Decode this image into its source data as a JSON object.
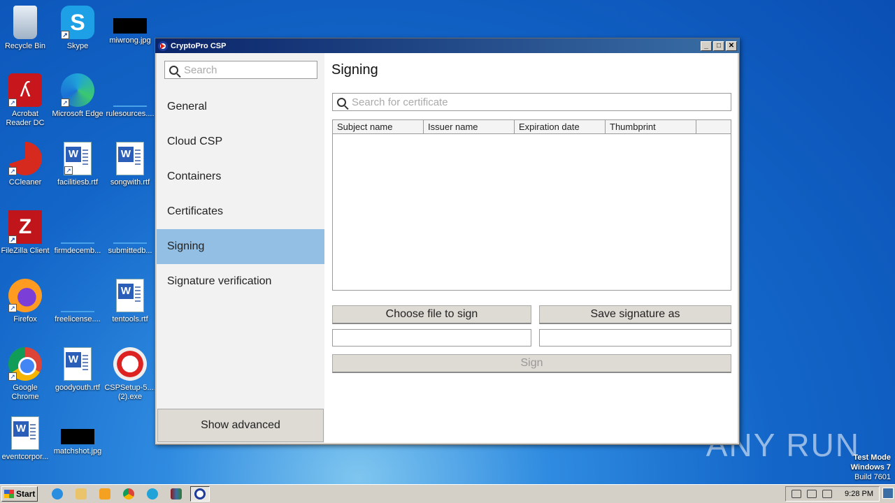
{
  "desktop": {
    "icons": [
      {
        "label": "Recycle Bin"
      },
      {
        "label": "Skype"
      },
      {
        "label": "miwrong.jpg"
      },
      {
        "label": "Acrobat Reader DC"
      },
      {
        "label": "Microsoft Edge"
      },
      {
        "label": "rulesources...."
      },
      {
        "label": "CCleaner"
      },
      {
        "label": "facilitiesb.rtf"
      },
      {
        "label": "songwith.rtf"
      },
      {
        "label": "FileZilla Client"
      },
      {
        "label": "firmdecemb..."
      },
      {
        "label": "submittedb..."
      },
      {
        "label": "Firefox"
      },
      {
        "label": "freelicense...."
      },
      {
        "label": "tentools.rtf"
      },
      {
        "label": "Google Chrome"
      },
      {
        "label": "goodyouth.rtf"
      },
      {
        "label": "CSPSetup-5.... (2).exe"
      },
      {
        "label": "eventcorpor..."
      },
      {
        "label": "matchshot.jpg"
      }
    ],
    "watermark": "ANY RUN",
    "test_mode": {
      "line1": "Test Mode",
      "line2": "Windows 7",
      "line3": "Build 7601"
    }
  },
  "window": {
    "title": "CryptoPro CSP",
    "sidebar": {
      "search_placeholder": "Search",
      "items": [
        {
          "label": "General"
        },
        {
          "label": "Cloud CSP"
        },
        {
          "label": "Containers"
        },
        {
          "label": "Certificates"
        },
        {
          "label": "Signing",
          "active": true
        },
        {
          "label": "Signature verification"
        }
      ],
      "show_advanced": "Show advanced"
    },
    "main": {
      "title": "Signing",
      "cert_search_placeholder": "Search for certificate",
      "columns": [
        "Subject name",
        "Issuer name",
        "Expiration date",
        "Thumbprint"
      ],
      "choose_file": "Choose file to sign",
      "save_signature": "Save signature as",
      "file_path": "",
      "signature_path": "",
      "sign": "Sign"
    }
  },
  "taskbar": {
    "start": "Start",
    "clock": "9:28 PM"
  }
}
